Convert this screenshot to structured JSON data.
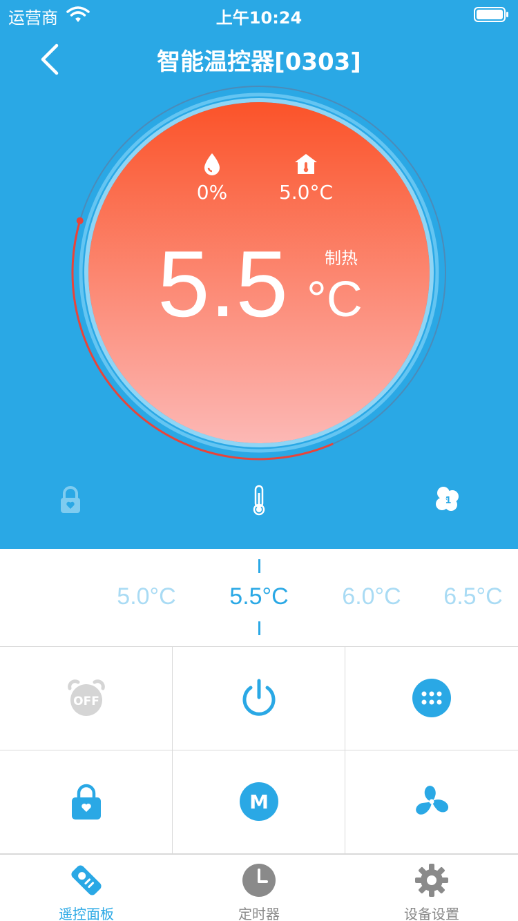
{
  "status_bar": {
    "carrier": "运营商",
    "time": "上午10:24",
    "icons": [
      "wifi-icon",
      "battery-icon"
    ]
  },
  "nav": {
    "title": "智能温控器[0303]",
    "back_icon": "chevron-left-icon"
  },
  "dial": {
    "humidity": "0%",
    "humidity_icon": "water-drop-icon",
    "room_temp": "5.0°C",
    "room_temp_icon": "house-thermometer-icon",
    "set_temp": "5.5",
    "unit": "°C",
    "mode": "制热",
    "arc_progress": 0.36
  },
  "status_icons": [
    "lock-icon",
    "thermometer-icon",
    "fan-speed-1-icon"
  ],
  "temperature_scroller": {
    "options": [
      "5.0°C",
      "5.5°C",
      "6.0°C",
      "6.5°C"
    ],
    "selected": "5.5°C"
  },
  "controls": [
    {
      "name": "timer-off-button",
      "icon": "alarm-off-icon"
    },
    {
      "name": "power-button",
      "icon": "power-icon"
    },
    {
      "name": "menu-button",
      "icon": "dots-grid-icon"
    },
    {
      "name": "child-lock-button",
      "icon": "lock-icon"
    },
    {
      "name": "mode-button",
      "icon": "mode-m-icon"
    },
    {
      "name": "fan-button",
      "icon": "fan-icon"
    }
  ],
  "tabs": [
    {
      "label": "遥控面板",
      "icon": "remote-control-icon",
      "active": true
    },
    {
      "label": "定时器",
      "icon": "clock-icon",
      "active": false
    },
    {
      "label": "设备设置",
      "icon": "gear-icon",
      "active": false
    }
  ],
  "colors": {
    "primary": "#2aa8e5",
    "dial_top": "#fb5329",
    "dial_bottom": "#fcb8b5",
    "arc": "#e8443a",
    "inactive": "#a9dbf4",
    "disabled": "#d5d5d5",
    "tab_inactive": "#8a8a8a"
  }
}
